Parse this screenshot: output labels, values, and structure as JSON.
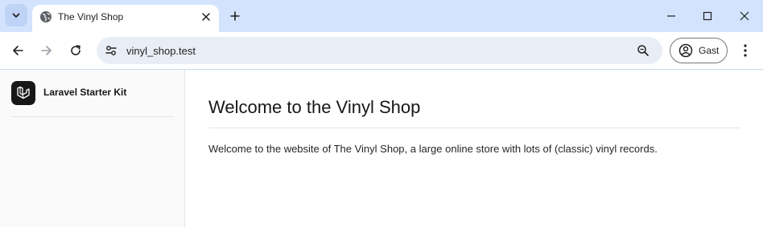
{
  "browser": {
    "tab": {
      "title": "The Vinyl Shop"
    },
    "address_bar": {
      "url": "vinyl_shop.test"
    },
    "profile": {
      "label": "Gast"
    }
  },
  "icons": [
    "tab-search-icon",
    "globe-icon",
    "close-icon",
    "plus-icon",
    "minimize-icon",
    "maximize-icon",
    "window-close-icon",
    "back-arrow-icon",
    "forward-arrow-icon",
    "reload-icon",
    "site-settings-icon",
    "zoom-icon",
    "account-circle-icon",
    "more-vert-icon",
    "laravel-logo-icon"
  ],
  "sidebar": {
    "brand_name": "Laravel Starter Kit"
  },
  "main": {
    "title": "Welcome to the Vinyl Shop",
    "intro": "Welcome to the website of The Vinyl Shop, a large online store with lots of (classic) vinyl records."
  },
  "colors": {
    "tabstrip": "#d3e3fd",
    "omnibox": "#e9eef6",
    "sidebar": "#fafafa",
    "logo_bg": "#171717",
    "text": "#171717"
  }
}
